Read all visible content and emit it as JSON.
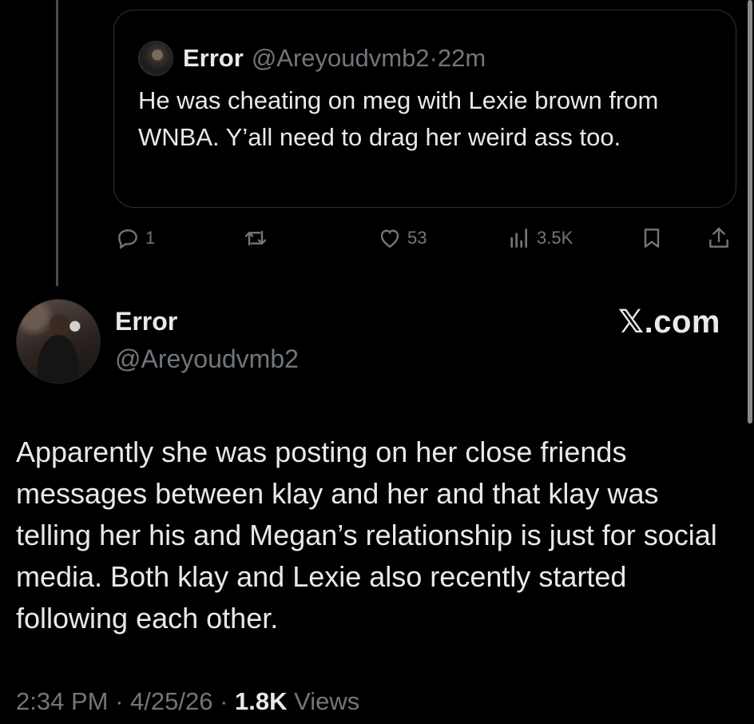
{
  "quoted_post": {
    "name": "Error",
    "handle": "@Areyoudvmb2",
    "separator": " · ",
    "time": "22m",
    "text": "He was cheating on meg with Lexie brown from WNBA. Y’all need to drag her weird ass too."
  },
  "actions": {
    "replies": "1",
    "likes": "53",
    "views": "3.5K"
  },
  "post": {
    "name": "Error",
    "handle": "@Areyoudvmb2",
    "brand": "𝕏.com",
    "text": "Apparently she was posting on her close friends messages between klay and her and that klay was telling her his and Megan’s relationship is just for social media. Both klay and Lexie also recently started following each other.",
    "time": "2:34 PM",
    "separator": " · ",
    "date": "4/25/26",
    "views_count": "1.8K",
    "views_label": " Views"
  },
  "icons": [
    "reply-icon",
    "repost-icon",
    "like-icon",
    "views-icon",
    "bookmark-icon",
    "share-icon"
  ],
  "colors": {
    "background": "#000000",
    "text": "#e7e9ea",
    "muted": "#71767b",
    "border": "#2f3336"
  }
}
